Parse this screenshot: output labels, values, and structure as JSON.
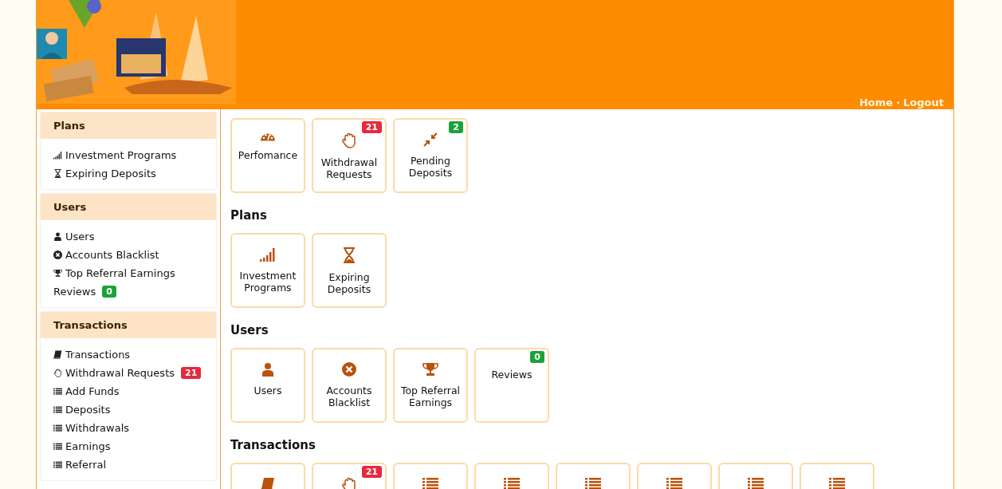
{
  "header": {
    "links": [
      {
        "label": "Home"
      },
      {
        "label": "Logout"
      }
    ],
    "separator": "·"
  },
  "sidebar": {
    "sections": [
      {
        "title": "Plans",
        "items": [
          {
            "label": "Investment Programs",
            "kind": "signal"
          },
          {
            "label": "Expiring Deposits",
            "kind": "hourglass"
          }
        ]
      },
      {
        "title": "Users",
        "items": [
          {
            "label": "Users",
            "kind": "user"
          },
          {
            "label": "Accounts Blacklist",
            "kind": "xcircle"
          },
          {
            "label": "Top Referral Earnings",
            "kind": "trophy"
          },
          {
            "label": "Reviews",
            "kind": "none",
            "badge": {
              "text": "0",
              "color": "#1aa33a"
            }
          }
        ]
      },
      {
        "title": "Transactions",
        "items": [
          {
            "label": "Transactions",
            "kind": "book"
          },
          {
            "label": "Withdrawal Requests",
            "kind": "hand",
            "badge": {
              "text": "21",
              "color": "#e8283c"
            }
          },
          {
            "label": "Add Funds",
            "kind": "list"
          },
          {
            "label": "Deposits",
            "kind": "list"
          },
          {
            "label": "Withdrawals",
            "kind": "list"
          },
          {
            "label": "Earnings",
            "kind": "list"
          },
          {
            "label": "Referral",
            "kind": "list"
          }
        ]
      }
    ]
  },
  "main": {
    "tiles": [
      {
        "label": "Perfomance",
        "kind": "gauge"
      },
      {
        "label": "Withdrawal Requests",
        "kind": "hand",
        "badge": {
          "text": "21",
          "color": "#e8283c"
        }
      },
      {
        "label": "Pending Deposits",
        "kind": "compress",
        "badge": {
          "text": "2",
          "color": "#1aa33a"
        }
      }
    ],
    "sections": [
      {
        "title": "Plans",
        "tiles": [
          {
            "label": "Investment Programs",
            "kind": "signal"
          },
          {
            "label": "Expiring Deposits",
            "kind": "hourglass"
          }
        ]
      },
      {
        "title": "Users",
        "tiles": [
          {
            "label": "Users",
            "kind": "user"
          },
          {
            "label": "Accounts Blacklist",
            "kind": "xcircle"
          },
          {
            "label": "Top Referral Earnings",
            "kind": "trophy"
          },
          {
            "label": "Reviews",
            "kind": "none",
            "badge": {
              "text": "0",
              "color": "#1aa33a"
            }
          }
        ]
      },
      {
        "title": "Transactions",
        "tiles": [
          {
            "kind": "book"
          },
          {
            "kind": "hand",
            "badge": {
              "text": "21",
              "color": "#e8283c"
            }
          },
          {
            "kind": "list"
          },
          {
            "kind": "list"
          },
          {
            "kind": "list"
          },
          {
            "kind": "list"
          },
          {
            "kind": "list"
          },
          {
            "kind": "list"
          }
        ]
      }
    ]
  }
}
